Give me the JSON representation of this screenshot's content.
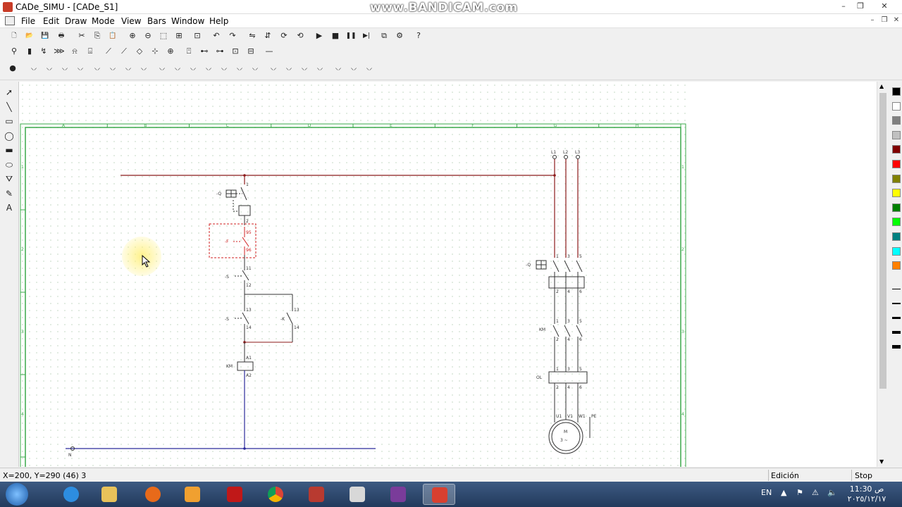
{
  "window": {
    "title": "CADe_SIMU - [CADe_S1]",
    "watermark": "www.BANDICAM.com",
    "controls": [
      "–",
      "❐",
      "✕"
    ],
    "mdi_controls": [
      "–",
      "❐",
      "✕"
    ]
  },
  "menu": {
    "items": [
      "File",
      "Edit",
      "Draw",
      "Mode",
      "View",
      "Bars",
      "Window",
      "Help"
    ]
  },
  "toolbar1": {
    "icons": [
      "new-icon",
      "open-icon",
      "save-icon",
      "print-icon",
      "cut-icon",
      "copy-icon",
      "paste-icon",
      "zoom-in-icon",
      "zoom-out-icon",
      "zoom-window-icon",
      "zoom-all-icon",
      "zoom-prev-icon",
      "undo-icon",
      "redo-icon",
      "mirror-h-icon",
      "mirror-v-icon",
      "rotate-icon",
      "rotate-back-icon",
      "play-icon",
      "stop-icon",
      "pause-icon",
      "step-icon",
      "window-icon",
      "settings-icon",
      "help-icon"
    ],
    "glyphs": [
      "🗋",
      "📂",
      "💾",
      "🖶",
      "✂",
      "⎘",
      "📋",
      "⊕",
      "⊖",
      "⬚",
      "⊞",
      "⊡",
      "↶",
      "↷",
      "⇋",
      "⇵",
      "⟳",
      "⟲",
      "▶",
      "■",
      "❚❚",
      "▶|",
      "⧉",
      "⚙",
      "?"
    ]
  },
  "toolbar2": {
    "glyphs": [
      "⚲",
      "▮",
      "↯",
      "⋙",
      "⍾",
      "⌺",
      "⟋",
      "⟋",
      "◇",
      "⊹",
      "⊕",
      "⍞",
      "⊷",
      "⊶",
      "⊡",
      "⊟",
      "—"
    ]
  },
  "toolbar3": {
    "glyphs": [
      "●",
      "⸜⸝",
      "⸜⸝",
      "⸜⸝",
      "⸜⸝",
      "⸜⸝",
      "⸜⸝",
      "⸜⸝",
      "⸜⸝",
      "⸜⸝",
      "⸜⸝",
      "⸜⸝",
      "⸜⸝",
      "⸜⸝",
      "⸜⸝",
      "⸜⸝",
      "⸜⸝",
      "⸜⸝",
      "⸜⸝",
      "⸜⸝",
      "⸜⸝",
      "⸜⸝",
      "⸜⸝"
    ]
  },
  "left_tools": {
    "glyphs": [
      "➚",
      "╲",
      "▭",
      "◯",
      "▬",
      "⬭",
      "⛛",
      "✎",
      "A"
    ]
  },
  "palette": {
    "colors": [
      "#000000",
      "#ffffff",
      "#808080",
      "#c0c0c0",
      "#800000",
      "#ff0000",
      "#808000",
      "#ffff00",
      "#008000",
      "#00ff00",
      "#008080",
      "#00ffff",
      "#ff8000"
    ]
  },
  "schematic": {
    "columns": [
      "A",
      "B",
      "C",
      "D",
      "E",
      "F",
      "G",
      "H"
    ],
    "rows": [
      "1",
      "2",
      "3",
      "4"
    ],
    "labels": {
      "q1": "-Q",
      "q1_top": "1",
      "q1_bot": "2",
      "f1": "-F",
      "f1_95": "95",
      "f1_96": "96",
      "s0": "-S",
      "s0_11": "11",
      "s0_12": "12",
      "s1": "-S",
      "s1_13": "13",
      "s1_14": "14",
      "km_aux": "-K",
      "km_13": "13",
      "km_14": "14",
      "km_coil": "KM",
      "a1": "A1",
      "a2": "A2",
      "l1": "L1",
      "l2": "L2",
      "l3": "L3",
      "q2": "-Q",
      "km_main": "KM",
      "ol": "OL",
      "u1": "U1",
      "v1": "V1",
      "w1": "W1",
      "pe": "PE",
      "motor": "M",
      "motor_phase": "3 ~",
      "n": "N",
      "power_terminals_top": [
        "1",
        "3",
        "5"
      ],
      "power_terminals_bot": [
        "2",
        "4",
        "6"
      ]
    }
  },
  "status": {
    "coords": "X=200, Y=290 (46) 3",
    "mode": "Edición",
    "sim": "Stop"
  },
  "taskbar": {
    "apps": [
      "ie",
      "explorer",
      "firefox",
      "media",
      "acrobat",
      "chrome",
      "cadesimu-alt",
      "winrar-x",
      "winrar",
      "cadesimu"
    ],
    "lang": "EN",
    "time": "11:30 ص",
    "date": "٢٠٢٥/١٢/١٧"
  }
}
